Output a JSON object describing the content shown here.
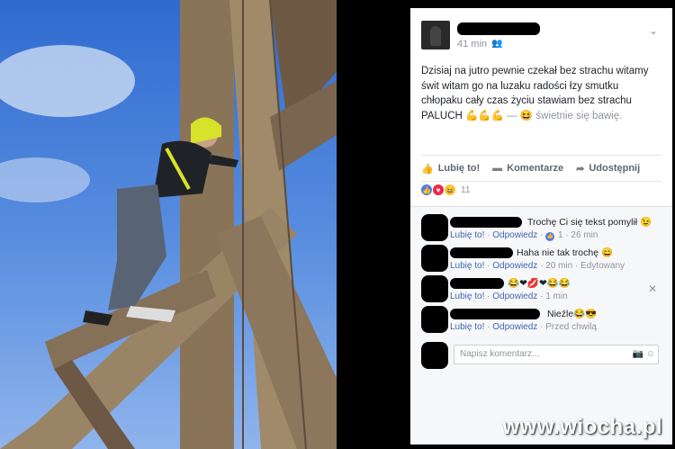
{
  "post": {
    "time": "41 min",
    "audience_icon": "friends-icon",
    "text_main": "Dzisiaj na jutro pewnie czekał bez strachu witamy świt witam go na luzaku radości łzy smutku chłopaku cały czas życiu stawiam bez strachu PALUCH",
    "text_emoji": "💪💪💪",
    "feeling_sep": " — ",
    "feeling_emoji": "😆",
    "feeling": "świetnie się bawię."
  },
  "actions": {
    "like": "Lubię to!",
    "comment": "Komentarze",
    "share": "Udostępnij"
  },
  "reactions": {
    "count": "11"
  },
  "comments": [
    {
      "text": "Trochę Ci się tekst pomylił 😉",
      "like": "Lubię to!",
      "reply": "Odpowiedz",
      "likes": "1",
      "time": "26 min"
    },
    {
      "text": "Haha nie tak trochę 😄",
      "like": "Lubię to!",
      "reply": "Odpowiedz",
      "time": "20 min",
      "edited": "Edytowany"
    },
    {
      "text": "😂❤💋❤😂😂",
      "like": "Lubię to!",
      "reply": "Odpowiedz",
      "time": "1 min"
    },
    {
      "text": "Nieźle😂😎",
      "like": "Lubię to!",
      "reply": "Odpowiedz",
      "time": "Przed chwilą"
    }
  ],
  "compose": {
    "placeholder": "Napisz komentarz..."
  },
  "watermark": "www.wiocha.pl"
}
